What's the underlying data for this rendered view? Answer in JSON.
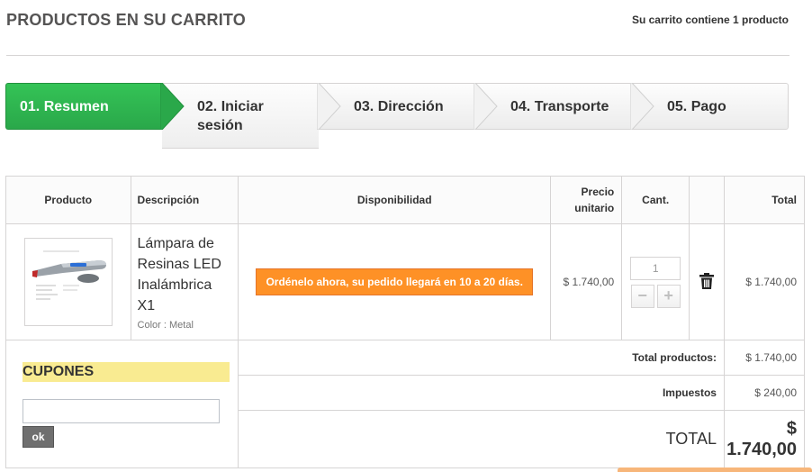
{
  "header": {
    "title": "PRODUCTOS EN SU CARRITO",
    "cart_summary": "Su carrito contiene 1 producto"
  },
  "steps": [
    {
      "label": "01. Resumen",
      "active": true
    },
    {
      "label": "02. Iniciar sesión",
      "active": false
    },
    {
      "label": "03. Dirección",
      "active": false
    },
    {
      "label": "04. Transporte",
      "active": false
    },
    {
      "label": "05. Pago",
      "active": false
    }
  ],
  "table": {
    "headers": {
      "product": "Producto",
      "description": "Descripción",
      "availability": "Disponibilidad",
      "unit_price": "Precio unitario",
      "qty": "Cant.",
      "total": "Total"
    },
    "item": {
      "name": "Lámpara de Resinas LED Inalámbrica X1",
      "attribute": "Color : Metal",
      "availability": "Ordénelo ahora, su pedido llegará en 10 a 20 días.",
      "unit_price": "$ 1.740,00",
      "qty": "1",
      "total": "$ 1.740,00"
    }
  },
  "coupons": {
    "title": "CUPONES",
    "input_value": "",
    "ok_label": "ok"
  },
  "totals": {
    "products_label": "Total productos:",
    "products_value": "$ 1.740,00",
    "tax_label": "Impuestos",
    "tax_value": "$ 240,00",
    "grand_label": "TOTAL",
    "grand_value": "$ 1.740,00"
  },
  "colors": {
    "active_step": "#2aa84a",
    "availability_badge": "#fe9126",
    "coupon_highlight": "#f9eb91"
  }
}
